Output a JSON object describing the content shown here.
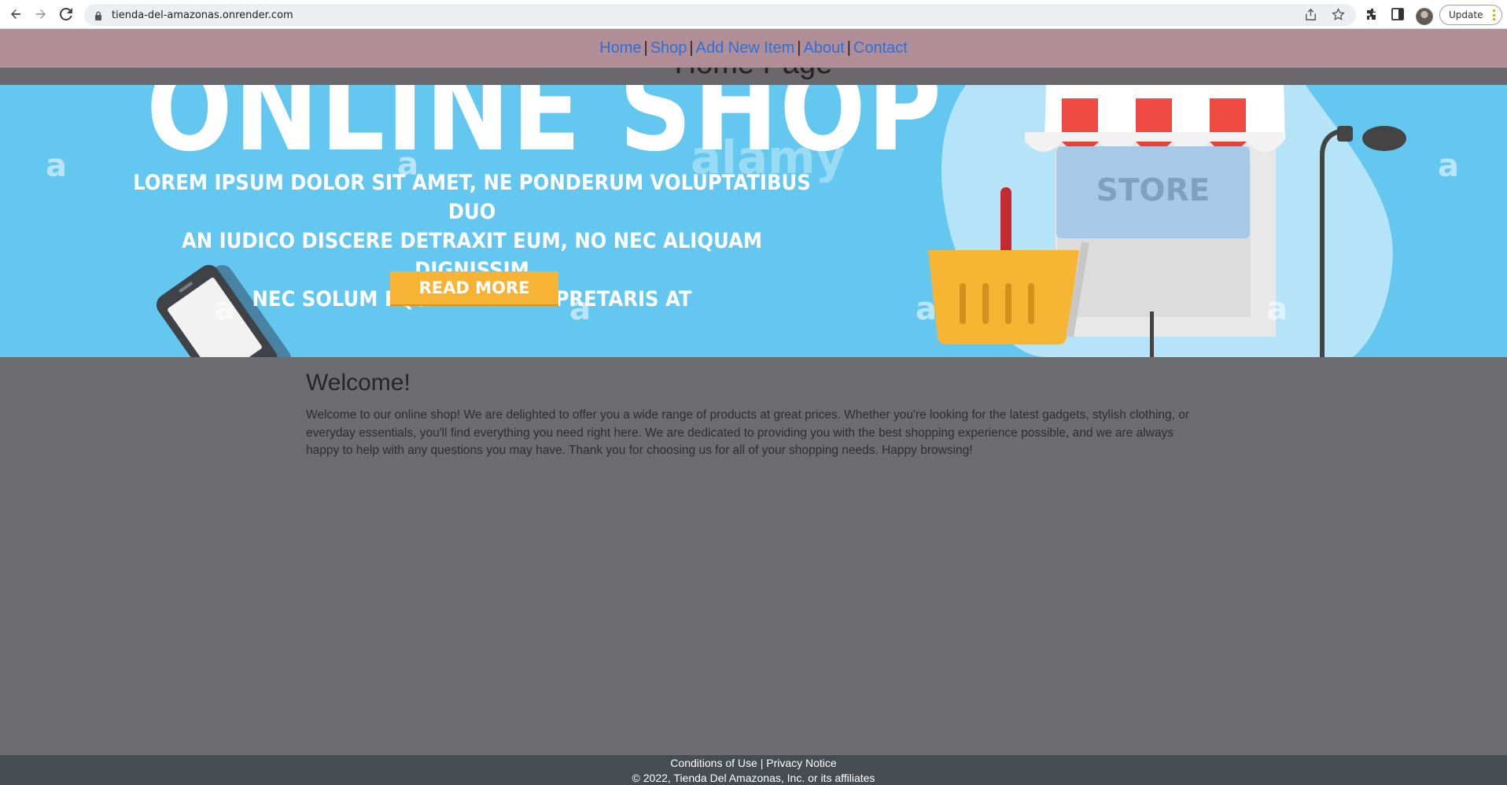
{
  "browser": {
    "url": "tienda-del-amazonas.onrender.com",
    "update_label": "Update",
    "icons": [
      "back-icon",
      "forward-icon",
      "reload-icon",
      "lock-icon",
      "share-icon",
      "star-icon",
      "extensions-icon",
      "side-panel-icon",
      "avatar",
      "menu-dots-icon"
    ]
  },
  "nav": {
    "links": [
      "Home",
      "Shop",
      "Add New Item",
      "About",
      "Contact"
    ],
    "separator": "|",
    "link_color": "#2f6fd8",
    "background": "#b18d95"
  },
  "page": {
    "heading": "Home Page"
  },
  "banner": {
    "headline": "ONLINE SHOP",
    "lorem_lines": [
      "LOREM IPSUM DOLOR SIT AMET, NE PONDERUM VOLUPTATIBUS DUO",
      "AN IUDICO DISCERE DETRAXIT EUM, NO NEC ALIQUAM DIGNISSIM",
      "NEC SOLUM EQUIDEM INTERPRETARIS AT"
    ],
    "read_more": "READ MORE",
    "store_sign": "STORE",
    "watermark_letter": "a",
    "watermark_word": "alamy",
    "background": "#63c7f0"
  },
  "main": {
    "welcome_title": "Welcome!",
    "welcome_text": "Welcome to our online shop! We are delighted to offer you a wide range of products at great prices. Whether you're looking for the latest gadgets, stylish clothing, or everyday essentials, you'll find everything you need right here. We are dedicated to providing you with the best shopping experience possible, and we are always happy to help with any questions you may have. Thank you for choosing us for all of your shopping needs. Happy browsing!"
  },
  "footer": {
    "conditions": "Conditions of Use",
    "separator": "|",
    "privacy": "Privacy Notice",
    "copyright": "© 2022, Tienda Del Amazonas, Inc. or its affiliates"
  }
}
